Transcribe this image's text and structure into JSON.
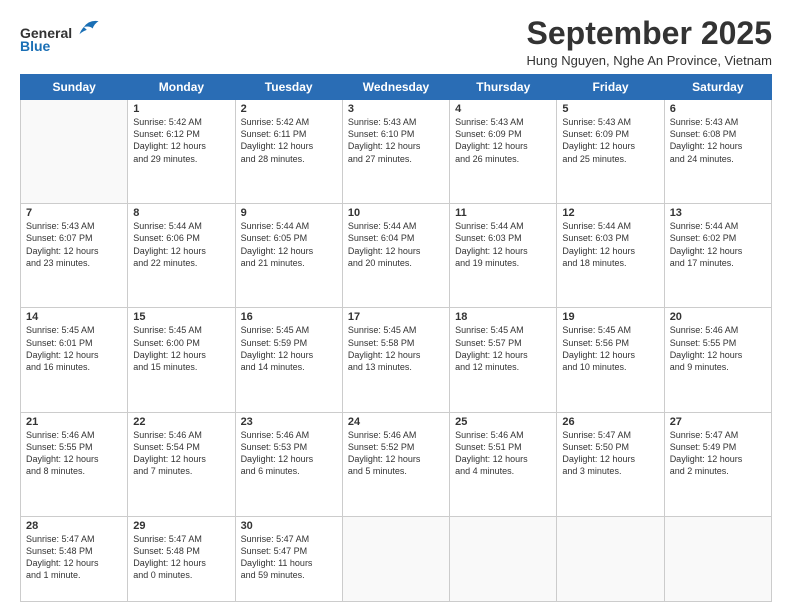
{
  "header": {
    "logo_line1": "General",
    "logo_line2": "Blue",
    "title": "September 2025",
    "subtitle": "Hung Nguyen, Nghe An Province, Vietnam"
  },
  "weekdays": [
    "Sunday",
    "Monday",
    "Tuesday",
    "Wednesday",
    "Thursday",
    "Friday",
    "Saturday"
  ],
  "weeks": [
    [
      {
        "day": "",
        "info": ""
      },
      {
        "day": "1",
        "info": "Sunrise: 5:42 AM\nSunset: 6:12 PM\nDaylight: 12 hours\nand 29 minutes."
      },
      {
        "day": "2",
        "info": "Sunrise: 5:42 AM\nSunset: 6:11 PM\nDaylight: 12 hours\nand 28 minutes."
      },
      {
        "day": "3",
        "info": "Sunrise: 5:43 AM\nSunset: 6:10 PM\nDaylight: 12 hours\nand 27 minutes."
      },
      {
        "day": "4",
        "info": "Sunrise: 5:43 AM\nSunset: 6:09 PM\nDaylight: 12 hours\nand 26 minutes."
      },
      {
        "day": "5",
        "info": "Sunrise: 5:43 AM\nSunset: 6:09 PM\nDaylight: 12 hours\nand 25 minutes."
      },
      {
        "day": "6",
        "info": "Sunrise: 5:43 AM\nSunset: 6:08 PM\nDaylight: 12 hours\nand 24 minutes."
      }
    ],
    [
      {
        "day": "7",
        "info": "Sunrise: 5:43 AM\nSunset: 6:07 PM\nDaylight: 12 hours\nand 23 minutes."
      },
      {
        "day": "8",
        "info": "Sunrise: 5:44 AM\nSunset: 6:06 PM\nDaylight: 12 hours\nand 22 minutes."
      },
      {
        "day": "9",
        "info": "Sunrise: 5:44 AM\nSunset: 6:05 PM\nDaylight: 12 hours\nand 21 minutes."
      },
      {
        "day": "10",
        "info": "Sunrise: 5:44 AM\nSunset: 6:04 PM\nDaylight: 12 hours\nand 20 minutes."
      },
      {
        "day": "11",
        "info": "Sunrise: 5:44 AM\nSunset: 6:03 PM\nDaylight: 12 hours\nand 19 minutes."
      },
      {
        "day": "12",
        "info": "Sunrise: 5:44 AM\nSunset: 6:03 PM\nDaylight: 12 hours\nand 18 minutes."
      },
      {
        "day": "13",
        "info": "Sunrise: 5:44 AM\nSunset: 6:02 PM\nDaylight: 12 hours\nand 17 minutes."
      }
    ],
    [
      {
        "day": "14",
        "info": "Sunrise: 5:45 AM\nSunset: 6:01 PM\nDaylight: 12 hours\nand 16 minutes."
      },
      {
        "day": "15",
        "info": "Sunrise: 5:45 AM\nSunset: 6:00 PM\nDaylight: 12 hours\nand 15 minutes."
      },
      {
        "day": "16",
        "info": "Sunrise: 5:45 AM\nSunset: 5:59 PM\nDaylight: 12 hours\nand 14 minutes."
      },
      {
        "day": "17",
        "info": "Sunrise: 5:45 AM\nSunset: 5:58 PM\nDaylight: 12 hours\nand 13 minutes."
      },
      {
        "day": "18",
        "info": "Sunrise: 5:45 AM\nSunset: 5:57 PM\nDaylight: 12 hours\nand 12 minutes."
      },
      {
        "day": "19",
        "info": "Sunrise: 5:45 AM\nSunset: 5:56 PM\nDaylight: 12 hours\nand 10 minutes."
      },
      {
        "day": "20",
        "info": "Sunrise: 5:46 AM\nSunset: 5:55 PM\nDaylight: 12 hours\nand 9 minutes."
      }
    ],
    [
      {
        "day": "21",
        "info": "Sunrise: 5:46 AM\nSunset: 5:55 PM\nDaylight: 12 hours\nand 8 minutes."
      },
      {
        "day": "22",
        "info": "Sunrise: 5:46 AM\nSunset: 5:54 PM\nDaylight: 12 hours\nand 7 minutes."
      },
      {
        "day": "23",
        "info": "Sunrise: 5:46 AM\nSunset: 5:53 PM\nDaylight: 12 hours\nand 6 minutes."
      },
      {
        "day": "24",
        "info": "Sunrise: 5:46 AM\nSunset: 5:52 PM\nDaylight: 12 hours\nand 5 minutes."
      },
      {
        "day": "25",
        "info": "Sunrise: 5:46 AM\nSunset: 5:51 PM\nDaylight: 12 hours\nand 4 minutes."
      },
      {
        "day": "26",
        "info": "Sunrise: 5:47 AM\nSunset: 5:50 PM\nDaylight: 12 hours\nand 3 minutes."
      },
      {
        "day": "27",
        "info": "Sunrise: 5:47 AM\nSunset: 5:49 PM\nDaylight: 12 hours\nand 2 minutes."
      }
    ],
    [
      {
        "day": "28",
        "info": "Sunrise: 5:47 AM\nSunset: 5:48 PM\nDaylight: 12 hours\nand 1 minute."
      },
      {
        "day": "29",
        "info": "Sunrise: 5:47 AM\nSunset: 5:48 PM\nDaylight: 12 hours\nand 0 minutes."
      },
      {
        "day": "30",
        "info": "Sunrise: 5:47 AM\nSunset: 5:47 PM\nDaylight: 11 hours\nand 59 minutes."
      },
      {
        "day": "",
        "info": ""
      },
      {
        "day": "",
        "info": ""
      },
      {
        "day": "",
        "info": ""
      },
      {
        "day": "",
        "info": ""
      }
    ]
  ]
}
